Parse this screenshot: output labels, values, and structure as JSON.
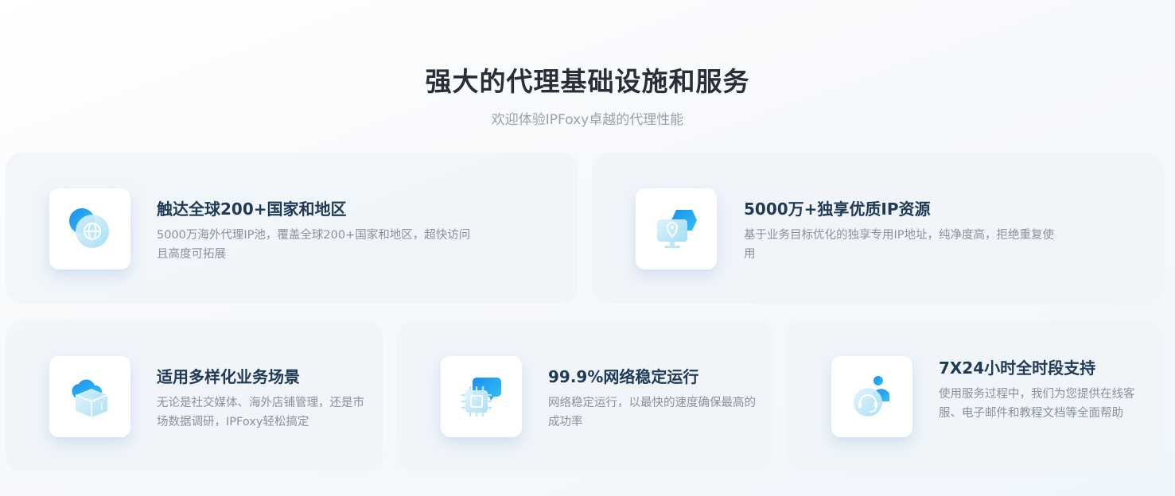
{
  "heading": {
    "title": "强大的代理基础设施和服务",
    "subtitle": "欢迎体验IPFoxy卓越的代理性能"
  },
  "features": [
    {
      "title": "触达全球200+国家和地区",
      "desc": "5000万海外代理IP池，覆盖全球200+国家和地区，超快访问且高度可拓展",
      "icon": "globe-icon"
    },
    {
      "title": "5000万+独享优质IP资源",
      "desc": "基于业务目标优化的独享专用IP地址，纯净度高，拒绝重复使用",
      "icon": "location-monitor-icon"
    },
    {
      "title": "适用多样化业务场景",
      "desc": "无论是社交媒体、海外店铺管理，还是市场数据调研，IPFoxy轻松搞定",
      "icon": "cube-cloud-icon"
    },
    {
      "title": "99.9%网络稳定运行",
      "desc": "网络稳定运行，以最快的速度确保最高的成功率",
      "icon": "chip-icon"
    },
    {
      "title": "7X24小时全时段支持",
      "desc": "使用服务过程中，我们为您提供在线客服、电子邮件和教程文档等全面帮助",
      "icon": "support-headset-icon"
    }
  ],
  "colors": {
    "accent_blue": "#1e9af0",
    "accent_cyan": "#3cc3f0",
    "title_dark": "#2b2d38",
    "card_title": "#1f3a56",
    "desc_gray": "#8b919b"
  }
}
